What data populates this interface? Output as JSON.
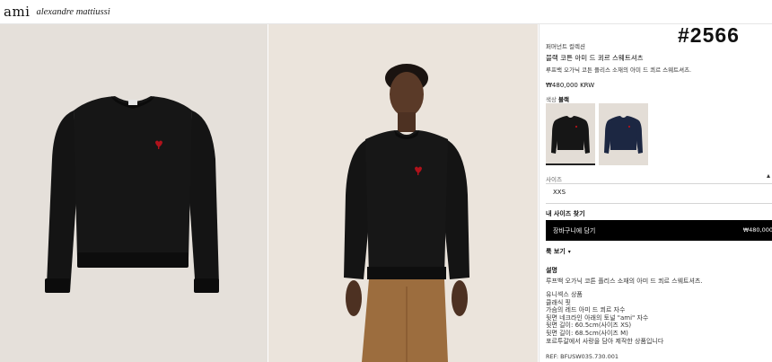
{
  "header": {
    "logo": "ami",
    "sublogo": "alexandre mattiussi"
  },
  "sku": "#2566",
  "product": {
    "collection": "퍼머넌트 컬렉션",
    "name": "블랙 코튼 아미 드 쾨르 스웨트셔츠",
    "short_desc": "루프백 오가닉 코튼 플리스 소재의 아미 드 쾨르 스웨트셔츠.",
    "price": "₩480,000 KRW"
  },
  "color": {
    "label": "색상",
    "value": "블랙",
    "swatches": [
      {
        "name": "black",
        "color": "#161616"
      },
      {
        "name": "navy",
        "color": "#1c2742"
      }
    ]
  },
  "size": {
    "label": "사이즈",
    "value": "XXS",
    "guide": "내 사이즈 찾기"
  },
  "cart": {
    "label": "장바구니에 담기",
    "price": "₩480,000"
  },
  "more": {
    "label": "룩 보기"
  },
  "description": {
    "title": "설명",
    "text": "루프백 오가닉 코튼 플리스 소재의 아미 드 쾨르 스웨트셔츠.",
    "features": [
      "유니섹스 상품",
      "클래식 핏",
      "가슴의 레드 아미 드 쾨르 자수",
      "뒷면 네크라인 아래의 토널 \"ami\" 자수",
      "뒷면 길이: 60.5cm(사이즈 XS)",
      "뒷면 길이: 68.5cm(사이즈 M)",
      "포르투갈에서 사랑을 담아 제작한 상품입니다"
    ],
    "ref": "REF: BFUSW035.730.001"
  },
  "colors": {
    "product_bg": "#e5e0da",
    "sweater": "#141414",
    "logo_red": "#b0121b",
    "button": "#000000"
  }
}
